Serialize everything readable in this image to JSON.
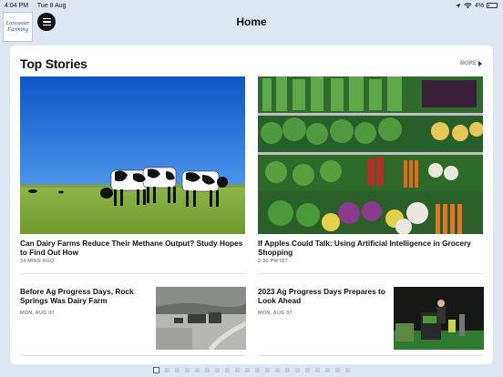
{
  "status": {
    "time": "4:04 PM",
    "date": "Tue 8 Aug",
    "battery": "4%"
  },
  "header": {
    "title": "Home",
    "logo_line1": "Lancaster",
    "logo_line2": "Farming"
  },
  "section": {
    "title": "Top Stories",
    "more_label": "MORE"
  },
  "stories": [
    {
      "headline": "Can Dairy Farms Reduce Their Methane Output? Study Hopes to Find Out How",
      "meta": "34 MINS AGO",
      "image": "cows-in-pasture"
    },
    {
      "headline": "If Apples Could Talk: Using Artificial Intelligence in Grocery Shopping",
      "meta": "2:30 PM IST",
      "image": "produce-display"
    },
    {
      "headline": "Before Ag Progress Days, Rock Springs Was Dairy Farm",
      "meta": "MON, AUG 07",
      "image": "historic-farm-photo"
    },
    {
      "headline": "2023 Ag Progress Days Prepares to Look Ahead",
      "meta": "MON, AUG 07",
      "image": "farm-show-podium"
    }
  ],
  "pager": {
    "count": 20,
    "active": 0
  },
  "icons": [
    "menu-icon",
    "location-arrow-icon",
    "wifi-icon",
    "battery-icon",
    "chevron-right-icon"
  ],
  "colors": {
    "background": "#dde6f3",
    "more_arrow": "#1e3556",
    "meta": "#8a8a8a"
  }
}
